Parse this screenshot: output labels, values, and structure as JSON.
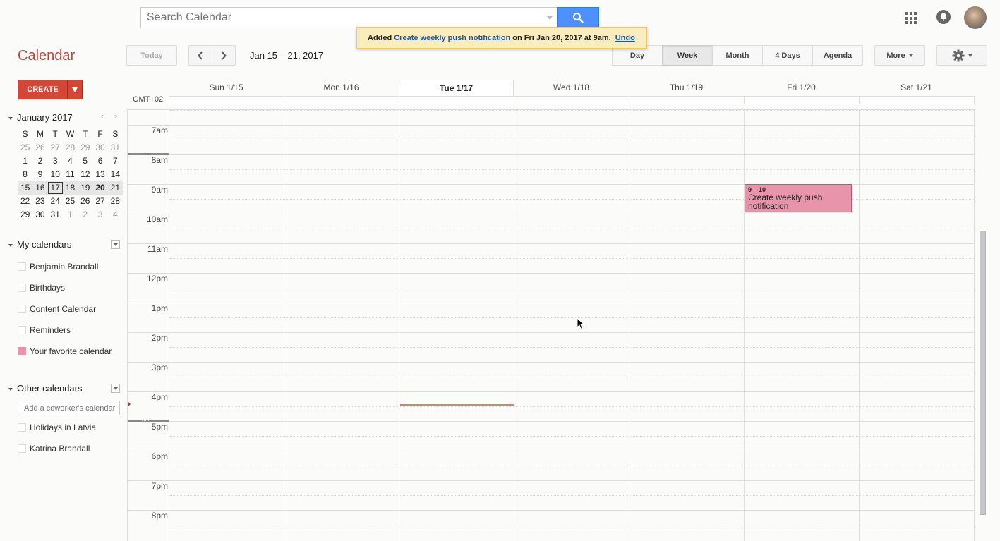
{
  "search": {
    "placeholder": "Search Calendar"
  },
  "toast": {
    "prefix": "Added",
    "event_link": "Create weekly push notification",
    "suffix": "on Fri Jan 20, 2017 at 9am.",
    "undo_label": "Undo"
  },
  "header": {
    "app_title": "Calendar",
    "today_label": "Today",
    "prev_label": "‹",
    "next_label": "›",
    "date_range": "Jan 15 – 21, 2017",
    "views": [
      "Day",
      "Week",
      "Month",
      "4 Days",
      "Agenda"
    ],
    "active_view": "Week",
    "more_label": "More"
  },
  "sidebar": {
    "create_label": "CREATE",
    "mini_calendar": {
      "title": "January 2017",
      "weekday_headers": [
        "S",
        "M",
        "T",
        "W",
        "T",
        "F",
        "S"
      ],
      "weeks": [
        [
          "25",
          "26",
          "27",
          "28",
          "29",
          "30",
          "31"
        ],
        [
          "1",
          "2",
          "3",
          "4",
          "5",
          "6",
          "7"
        ],
        [
          "8",
          "9",
          "10",
          "11",
          "12",
          "13",
          "14"
        ],
        [
          "15",
          "16",
          "17",
          "18",
          "19",
          "20",
          "21"
        ],
        [
          "22",
          "23",
          "24",
          "25",
          "26",
          "27",
          "28"
        ],
        [
          "29",
          "30",
          "31",
          "1",
          "2",
          "3",
          "4"
        ]
      ],
      "today": "17",
      "selected_day": "20"
    },
    "my_calendars": {
      "title": "My calendars",
      "items": [
        {
          "label": "Benjamin Brandall",
          "color": ""
        },
        {
          "label": "Birthdays",
          "color": ""
        },
        {
          "label": "Content Calendar",
          "color": ""
        },
        {
          "label": "Reminders",
          "color": ""
        },
        {
          "label": "Your favorite calendar",
          "color": "#e895ab"
        }
      ]
    },
    "other_calendars": {
      "title": "Other calendars",
      "add_placeholder": "Add a coworker's calendar",
      "items": [
        {
          "label": "Holidays in Latvia"
        },
        {
          "label": "Katrina Brandall"
        }
      ]
    }
  },
  "grid": {
    "timezone": "GMT+02",
    "days": [
      "Sun 1/15",
      "Mon 1/16",
      "Tue 1/17",
      "Wed 1/18",
      "Thu 1/19",
      "Fri 1/20",
      "Sat 1/21"
    ],
    "today_index": 2,
    "hours": [
      "7am",
      "8am",
      "9am",
      "10am",
      "11am",
      "12pm",
      "1pm",
      "2pm",
      "3pm",
      "4pm",
      "5pm",
      "6pm",
      "7pm",
      "8pm"
    ],
    "events": [
      {
        "time": "9 – 10",
        "title": "Create weekly push notification",
        "day": "Fri 1/20",
        "color": "#e895ab"
      }
    ]
  }
}
